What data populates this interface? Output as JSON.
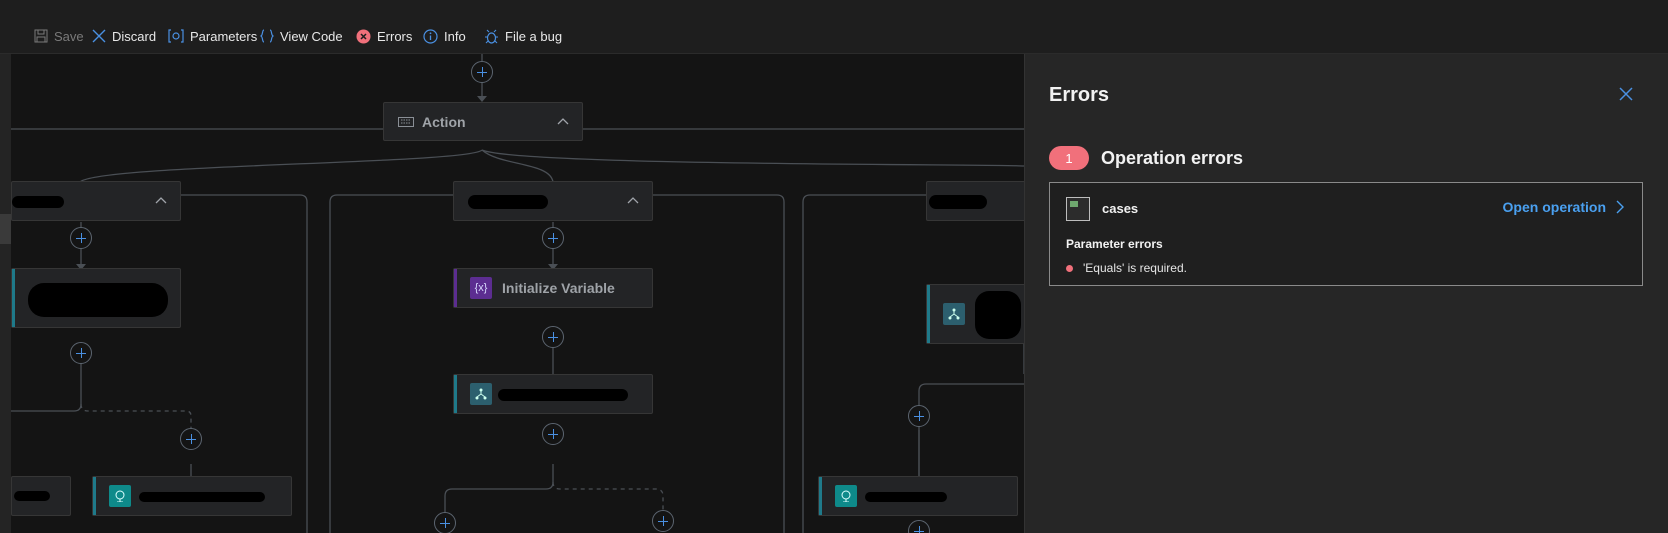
{
  "toolbar": {
    "save_label": "Save",
    "discard_label": "Discard",
    "parameters_label": "Parameters",
    "view_code_label": "View Code",
    "errors_label": "Errors",
    "info_label": "Info",
    "file_bug_label": "File a bug"
  },
  "canvas": {
    "action_label": "Action",
    "init_var_label": "Initialize Variable",
    "init_var_icon_text": "{x}"
  },
  "errors_panel": {
    "title": "Errors",
    "count": "1",
    "section_title": "Operation errors",
    "error_item": {
      "name": "cases",
      "open_label": "Open operation",
      "param_errors_heading": "Parameter errors",
      "message": "'Equals' is required."
    }
  },
  "colors": {
    "accent_blue": "#4aa0f0",
    "error_red": "#f1707b",
    "variable_purple": "#5c2d91",
    "connector_teal": "#1f7a8a"
  }
}
